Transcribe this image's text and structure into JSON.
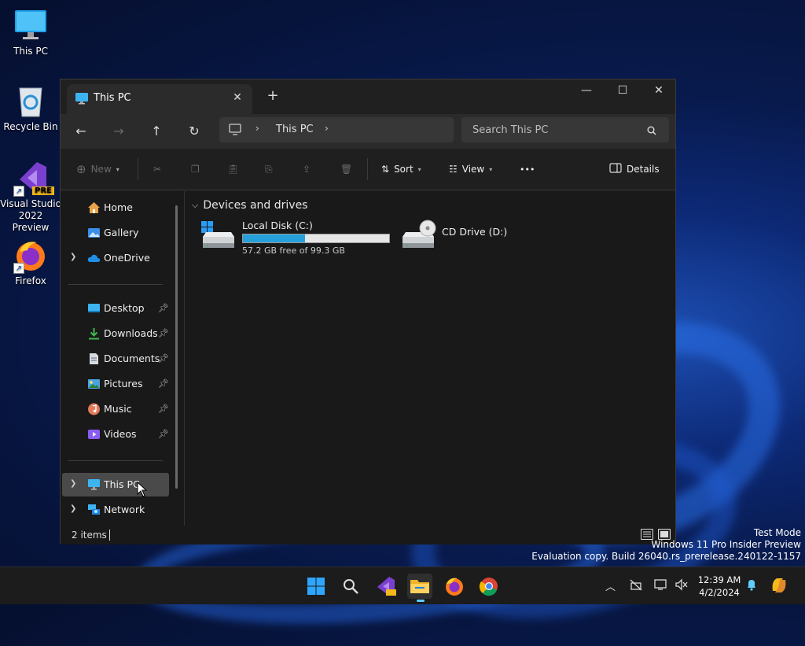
{
  "desktop": {
    "icons": [
      {
        "label": "This PC"
      },
      {
        "label": "Recycle Bin"
      },
      {
        "label": "Visual Studio 2022 Preview",
        "badge": "PRE"
      },
      {
        "label": "Firefox"
      }
    ]
  },
  "window": {
    "tab_title": "This PC",
    "address": {
      "crumb": "This PC"
    },
    "search": {
      "placeholder": "Search This PC"
    },
    "commands": {
      "new": "New",
      "sort": "Sort",
      "view": "View",
      "more": "•••",
      "details": "Details"
    },
    "sidebar": {
      "items": [
        {
          "label": "Home"
        },
        {
          "label": "Gallery"
        },
        {
          "label": "OneDrive"
        },
        {
          "label": "Desktop"
        },
        {
          "label": "Downloads"
        },
        {
          "label": "Documents"
        },
        {
          "label": "Pictures"
        },
        {
          "label": "Music"
        },
        {
          "label": "Videos"
        },
        {
          "label": "This PC"
        },
        {
          "label": "Network"
        }
      ]
    },
    "content": {
      "group_title": "Devices and drives",
      "drives": [
        {
          "label": "Local Disk (C:)",
          "free_text": "57.2 GB free of 99.3 GB",
          "used_fraction": 0.424
        },
        {
          "label": "CD Drive (D:)"
        }
      ]
    },
    "status": {
      "item_count": "2 items"
    }
  },
  "watermark": {
    "line1": "Test Mode",
    "line2": "Windows 11 Pro Insider Preview",
    "line3": "Evaluation copy. Build 26040.rs_prerelease.240122-1157"
  },
  "taskbar": {
    "clock_time": "12:39 AM",
    "clock_date": "4/2/2024"
  },
  "colors": {
    "accent": "#60cdff",
    "drive_bar": "#26a0da"
  }
}
